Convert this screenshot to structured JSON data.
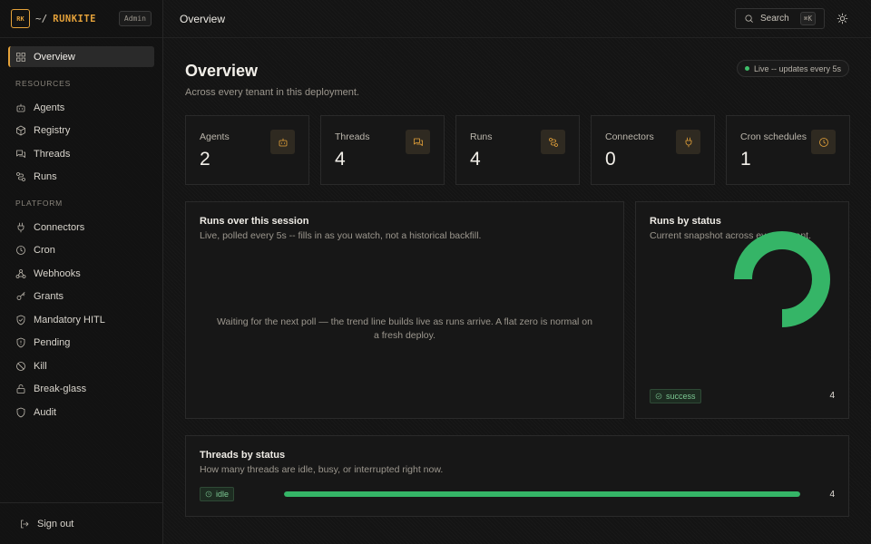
{
  "brand": {
    "logo": "RK",
    "path": "~/",
    "name": "RUNKITE",
    "badge": "Admin"
  },
  "nav": {
    "overview": "Overview",
    "resources_heading": "RESOURCES",
    "agents": "Agents",
    "registry": "Registry",
    "threads": "Threads",
    "runs": "Runs",
    "platform_heading": "PLATFORM",
    "connectors": "Connectors",
    "cron": "Cron",
    "webhooks": "Webhooks",
    "grants": "Grants",
    "mandatory_hitl": "Mandatory HITL",
    "pending": "Pending",
    "kill": "Kill",
    "break_glass": "Break-glass",
    "audit": "Audit",
    "sign_out": "Sign out"
  },
  "topbar": {
    "title": "Overview",
    "search_label": "Search",
    "search_shortcut": "⌘K"
  },
  "header": {
    "title": "Overview",
    "subtitle": "Across every tenant in this deployment.",
    "live_badge": "Live -- updates every 5s"
  },
  "stats": [
    {
      "label": "Agents",
      "value": "2",
      "icon": "bot-icon"
    },
    {
      "label": "Threads",
      "value": "4",
      "icon": "chat-icon"
    },
    {
      "label": "Runs",
      "value": "4",
      "icon": "route-icon"
    },
    {
      "label": "Connectors",
      "value": "0",
      "icon": "plug-icon"
    },
    {
      "label": "Cron schedules",
      "value": "1",
      "icon": "clock-icon"
    }
  ],
  "runs_session": {
    "title": "Runs over this session",
    "subtitle": "Live, polled every 5s -- fills in as you watch, not a historical backfill.",
    "empty_message": "Waiting for the next poll — the trend line builds live as runs arrive. A flat zero is normal on a fresh deploy."
  },
  "runs_status": {
    "title": "Runs by status",
    "subtitle": "Current snapshot across every tenant.",
    "legend": [
      {
        "label": "success",
        "count": "4",
        "color": "#35b567"
      }
    ]
  },
  "threads_status": {
    "title": "Threads by status",
    "subtitle": "How many threads are idle, busy, or interrupted right now.",
    "rows": [
      {
        "label": "idle",
        "count": "4",
        "fraction": 1.0,
        "color": "#35b567"
      }
    ]
  },
  "colors": {
    "accent": "#e5a23a",
    "success": "#35b567",
    "live": "#3fbf6a"
  }
}
